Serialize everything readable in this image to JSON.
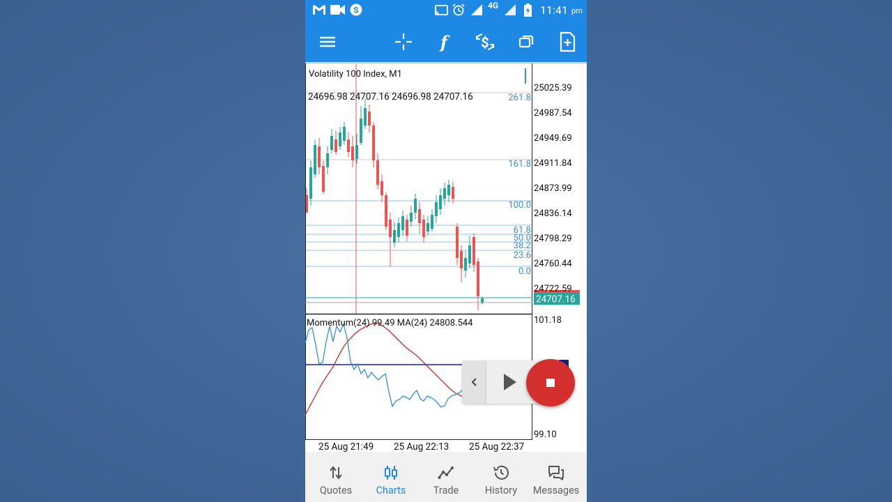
{
  "status_bar": {
    "time": "11:41",
    "ampm": "pm",
    "network": "4G"
  },
  "chart": {
    "symbol_title": "Volatility 100 Index, M1",
    "ohlc": "24696.98 24707.16 24696.98 24707.16",
    "price_labels": [
      "25025.39",
      "24987.54",
      "24949.69",
      "24911.84",
      "24873.99",
      "24836.14",
      "24798.29",
      "24760.44",
      "24722.59"
    ],
    "current_price": "24707.16",
    "fib_levels": [
      "261.8",
      "161.8",
      "100.0",
      "61.8",
      "50.0",
      "38.2",
      "23.6",
      "0.0"
    ],
    "indicator_title": "Momentum(24) 99.49 MA(24) 24808.544",
    "indicator_scale_top": "101.18",
    "indicator_scale_bottom": "99.10",
    "time_labels": [
      "25 Aug 21:49",
      "25 Aug 22:13",
      "25 Aug 22:37"
    ],
    "colors": {
      "bull": "#26a69a",
      "bear": "#ef5350",
      "fib": "#3a8fd0",
      "momentum": "#2b8fd6",
      "ma": "#d32f2f",
      "accent": "#1e88e5"
    }
  },
  "bottom_nav": {
    "items": [
      {
        "label": "Quotes",
        "icon": "quotes-arrows-icon"
      },
      {
        "label": "Charts",
        "icon": "candlestick-icon"
      },
      {
        "label": "Trade",
        "icon": "trend-line-icon"
      },
      {
        "label": "History",
        "icon": "history-clock-icon"
      },
      {
        "label": "Messages",
        "icon": "chat-bubbles-icon"
      }
    ],
    "active": "Charts"
  }
}
